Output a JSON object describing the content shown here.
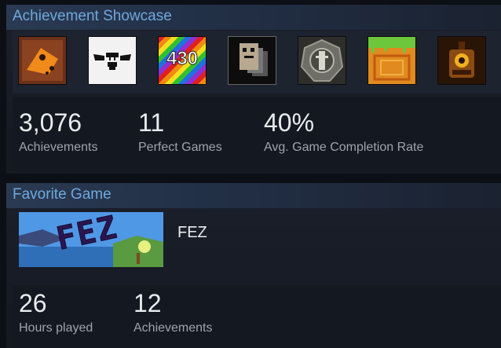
{
  "showcase": {
    "title": "Achievement Showcase",
    "achievements": [
      {
        "icon": "orange-fish-badge-icon"
      },
      {
        "icon": "winged-heart-badge-icon"
      },
      {
        "icon": "rainbow-430-badge-icon",
        "text": "430"
      },
      {
        "icon": "pixel-robot-stack-icon"
      },
      {
        "icon": "stone-totem-medallion-icon"
      },
      {
        "icon": "grass-block-badge-icon"
      },
      {
        "icon": "gear-lantern-badge-icon"
      }
    ],
    "stats": [
      {
        "value": "3,076",
        "label": "Achievements"
      },
      {
        "value": "11",
        "label": "Perfect Games"
      },
      {
        "value": "40%",
        "label": "Avg. Game Completion Rate"
      }
    ]
  },
  "favorite": {
    "title": "Favorite Game",
    "game_name": "FEZ",
    "art_text": "FEZ",
    "stats": [
      {
        "value": "26",
        "label": "Hours played"
      },
      {
        "value": "12",
        "label": "Achievements"
      }
    ]
  },
  "colors": {
    "accent": "#6fa9de",
    "panel_bg": "#1a1f2b",
    "page_bg": "#0c0f15",
    "label": "#9ea4ad"
  }
}
